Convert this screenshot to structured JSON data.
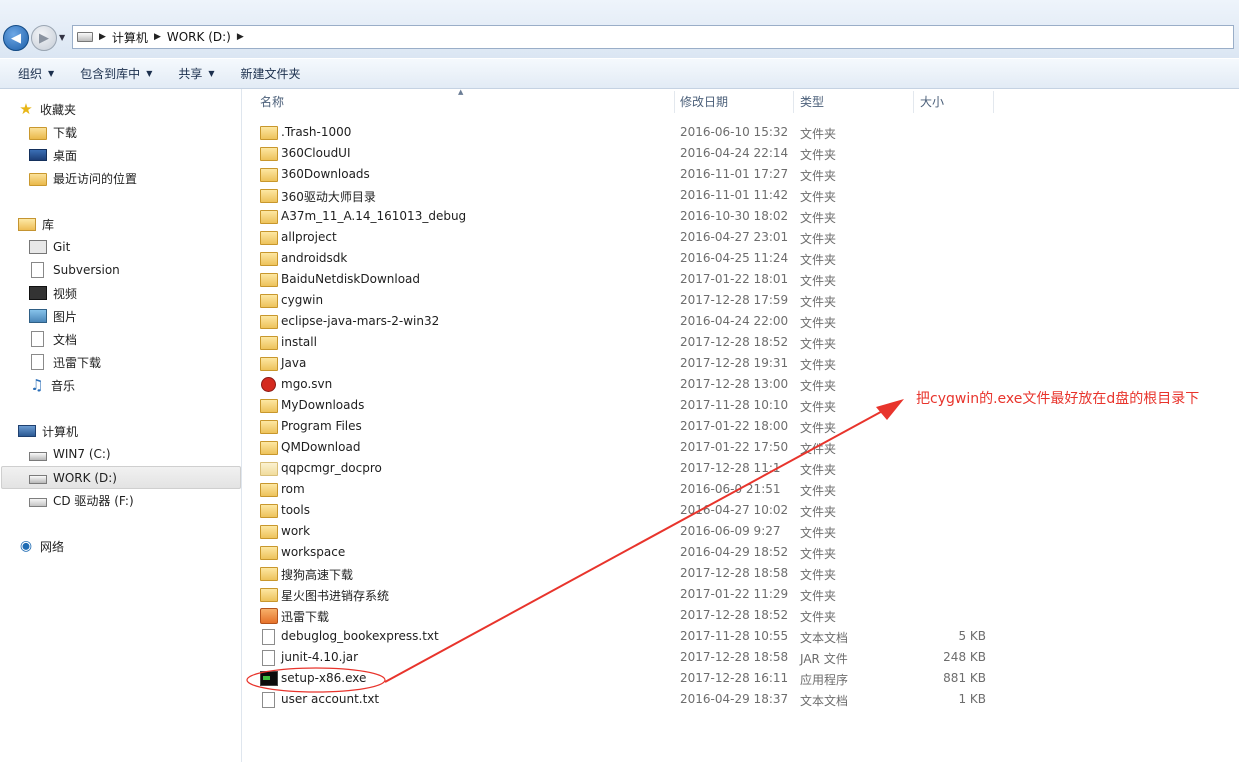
{
  "address_bar": {
    "breadcrumbs": [
      "计算机",
      "WORK (D:)"
    ]
  },
  "toolbar": {
    "organize": "组织",
    "include_in_library": "包含到库中",
    "share": "共享",
    "new_folder": "新建文件夹"
  },
  "nav": {
    "favorites": {
      "label": "收藏夹",
      "items": [
        "下载",
        "桌面",
        "最近访问的位置"
      ]
    },
    "libraries": {
      "label": "库",
      "items": [
        "Git",
        "Subversion",
        "视频",
        "图片",
        "文档",
        "迅雷下载",
        "音乐"
      ]
    },
    "computer": {
      "label": "计算机",
      "items": [
        "WIN7 (C:)",
        "WORK (D:)",
        "CD 驱动器 (F:)"
      ],
      "selected": "WORK (D:)"
    },
    "network": {
      "label": "网络"
    }
  },
  "columns": {
    "name": "名称",
    "date": "修改日期",
    "type": "类型",
    "size": "大小"
  },
  "files": [
    {
      "name": ".Trash-1000",
      "date": "2016-06-10 15:32",
      "type": "文件夹",
      "size": "",
      "icon": "folder-icon"
    },
    {
      "name": "360CloudUI",
      "date": "2016-04-24 22:14",
      "type": "文件夹",
      "size": "",
      "icon": "folder-icon"
    },
    {
      "name": "360Downloads",
      "date": "2016-11-01 17:27",
      "type": "文件夹",
      "size": "",
      "icon": "folder-icon"
    },
    {
      "name": "360驱动大师目录",
      "date": "2016-11-01 11:42",
      "type": "文件夹",
      "size": "",
      "icon": "folder-icon"
    },
    {
      "name": "A37m_11_A.14_161013_debug",
      "date": "2016-10-30 18:02",
      "type": "文件夹",
      "size": "",
      "icon": "folder-icon"
    },
    {
      "name": "allproject",
      "date": "2016-04-27 23:01",
      "type": "文件夹",
      "size": "",
      "icon": "folder-icon"
    },
    {
      "name": "androidsdk",
      "date": "2016-04-25 11:24",
      "type": "文件夹",
      "size": "",
      "icon": "folder-icon"
    },
    {
      "name": "BaiduNetdiskDownload",
      "date": "2017-01-22 18:01",
      "type": "文件夹",
      "size": "",
      "icon": "folder-icon"
    },
    {
      "name": "cygwin",
      "date": "2017-12-28 17:59",
      "type": "文件夹",
      "size": "",
      "icon": "folder-icon"
    },
    {
      "name": "eclipse-java-mars-2-win32",
      "date": "2016-04-24 22:00",
      "type": "文件夹",
      "size": "",
      "icon": "folder-icon"
    },
    {
      "name": "install",
      "date": "2017-12-28 18:52",
      "type": "文件夹",
      "size": "",
      "icon": "folder-icon"
    },
    {
      "name": "Java",
      "date": "2017-12-28 19:31",
      "type": "文件夹",
      "size": "",
      "icon": "folder-icon"
    },
    {
      "name": "mgo.svn",
      "date": "2017-12-28 13:00",
      "type": "文件夹",
      "size": "",
      "icon": "svn-conflict-icon"
    },
    {
      "name": "MyDownloads",
      "date": "2017-11-28 10:10",
      "type": "文件夹",
      "size": "",
      "icon": "folder-icon"
    },
    {
      "name": "Program Files",
      "date": "2017-01-22 18:00",
      "type": "文件夹",
      "size": "",
      "icon": "folder-icon"
    },
    {
      "name": "QMDownload",
      "date": "2017-01-22 17:50",
      "type": "文件夹",
      "size": "",
      "icon": "folder-icon"
    },
    {
      "name": "qqpcmgr_docpro",
      "date": "2017-12-28 11:1",
      "type": "文件夹",
      "size": "",
      "icon": "folder-light-icon"
    },
    {
      "name": "rom",
      "date": "2016-06-0 21:51",
      "type": "文件夹",
      "size": "",
      "icon": "folder-icon"
    },
    {
      "name": "tools",
      "date": "2016-04-27 10:02",
      "type": "文件夹",
      "size": "",
      "icon": "folder-icon"
    },
    {
      "name": "work",
      "date": "2016-06-09 9:27",
      "type": "文件夹",
      "size": "",
      "icon": "folder-icon"
    },
    {
      "name": "workspace",
      "date": "2016-04-29 18:52",
      "type": "文件夹",
      "size": "",
      "icon": "folder-icon"
    },
    {
      "name": "搜狗高速下载",
      "date": "2017-12-28 18:58",
      "type": "文件夹",
      "size": "",
      "icon": "folder-icon"
    },
    {
      "name": "星火图书进销存系统",
      "date": "2017-01-22 11:29",
      "type": "文件夹",
      "size": "",
      "icon": "folder-icon"
    },
    {
      "name": "迅雷下载",
      "date": "2017-12-28 18:52",
      "type": "文件夹",
      "size": "",
      "icon": "thunder-folder-icon"
    },
    {
      "name": "debuglog_bookexpress.txt",
      "date": "2017-11-28 10:55",
      "type": "文本文档",
      "size": "5 KB",
      "icon": "text-file-icon"
    },
    {
      "name": "junit-4.10.jar",
      "date": "2017-12-28 18:58",
      "type": "JAR 文件",
      "size": "248 KB",
      "icon": "jar-file-icon"
    },
    {
      "name": "setup-x86.exe",
      "date": "2017-12-28 16:11",
      "type": "应用程序",
      "size": "881 KB",
      "icon": "exe-icon"
    },
    {
      "name": "user account.txt",
      "date": "2016-04-29 18:37",
      "type": "文本文档",
      "size": "1 KB",
      "icon": "text-file-icon"
    }
  ],
  "annotation": {
    "text": "把cygwin的.exe文件最好放在d盘的根目录下",
    "color": "#e8342c"
  }
}
